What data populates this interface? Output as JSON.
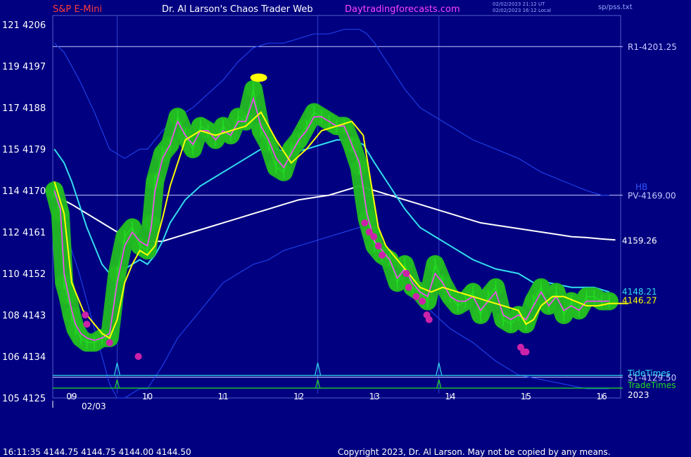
{
  "header": {
    "symbol": "S&P E-Mini",
    "title": "Dr. Al Larson's Chaos Trader Web",
    "website": "Daytradingforecasts.com",
    "timestamp_ut": "02/02/2023 21:12 UT",
    "timestamp_local": "02/02/2023 16:12 Local",
    "file": "sp/pss.txt"
  },
  "footer": {
    "quote": "16:11:35  4144.75 4144.75 4144.00 4144.50",
    "copyright": "Copyright 2023, Dr. Al Larson. May not be copied by any means."
  },
  "chart_data": {
    "type": "line",
    "ylim": [
      4125,
      4208
    ],
    "xlim": [
      8.75,
      16.25
    ],
    "y_ticks": [
      {
        "left": "121",
        "right": "4206",
        "v": 4206
      },
      {
        "left": "119",
        "right": "4197",
        "v": 4197
      },
      {
        "left": "117",
        "right": "4188",
        "v": 4188
      },
      {
        "left": "115",
        "right": "4179",
        "v": 4179
      },
      {
        "left": "114",
        "right": "4170",
        "v": 4170
      },
      {
        "left": "112",
        "right": "4161",
        "v": 4161
      },
      {
        "left": "110",
        "right": "4152",
        "v": 4152
      },
      {
        "left": "108",
        "right": "4143",
        "v": 4143
      },
      {
        "left": "106",
        "right": "4134",
        "v": 4134
      },
      {
        "left": "105",
        "right": "4125",
        "v": 4125
      }
    ],
    "x_ticks": [
      {
        "label": "09",
        "v": 9
      },
      {
        "label": "10",
        "v": 10
      },
      {
        "label": "11",
        "v": 11
      },
      {
        "label": "12",
        "v": 12
      },
      {
        "label": "13",
        "v": 13
      },
      {
        "label": "14",
        "v": 14
      },
      {
        "label": "15",
        "v": 15
      },
      {
        "label": "16",
        "v": 16
      }
    ],
    "date_label": "02/03",
    "year_label": "2023",
    "hlines": [
      {
        "label": "R1-4201.25",
        "value": 4201.25,
        "color": "#c8c8ff"
      },
      {
        "label": "PV-4169.00",
        "value": 4169.0,
        "color": "#c8c8ff"
      },
      {
        "label": "S1-4129.50",
        "value": 4129.5,
        "color": "#c8c8ff"
      }
    ],
    "vlines": [
      9.6,
      12.25,
      13.85
    ],
    "labels": {
      "hb": "HB",
      "tide": "TideTimes",
      "trade": "TradeTimes"
    },
    "colors": {
      "price": "#22dd22",
      "halo": "#22bb22",
      "fast_avg": "#ff44ff",
      "yellow": "#ffff00",
      "cyan": "#33ddee",
      "white": "#ffffff",
      "band": "#1e3ee6",
      "marker": "#cc22aa",
      "bg": "#000080"
    },
    "series": [
      {
        "key": "price",
        "x": [
          8.77,
          8.85,
          8.9,
          8.95,
          9.0,
          9.05,
          9.12,
          9.2,
          9.3,
          9.4,
          9.5,
          9.6,
          9.7,
          9.8,
          9.9,
          10.0,
          10.05,
          10.1,
          10.2,
          10.3,
          10.4,
          10.5,
          10.6,
          10.7,
          10.8,
          10.9,
          11.0,
          11.1,
          11.2,
          11.3,
          11.4,
          11.5,
          11.6,
          11.7,
          11.8,
          11.9,
          12.0,
          12.1,
          12.2,
          12.3,
          12.4,
          12.5,
          12.6,
          12.7,
          12.8,
          12.9,
          12.95,
          13.0,
          13.1,
          13.2,
          13.3,
          13.4,
          13.5,
          13.6,
          13.7,
          13.8,
          13.9,
          14.0,
          14.1,
          14.2,
          14.3,
          14.4,
          14.5,
          14.6,
          14.7,
          14.8,
          14.9,
          15.0,
          15.1,
          15.2,
          15.3,
          15.4,
          15.5,
          15.6,
          15.7,
          15.8,
          15.9,
          16.0,
          16.1
        ],
        "y": [
          4170,
          4165,
          4150,
          4147,
          4143,
          4140,
          4138,
          4137,
          4137,
          4138,
          4138,
          4152,
          4160,
          4162,
          4158,
          4157,
          4163,
          4172,
          4178,
          4180,
          4186,
          4182,
          4179,
          4184,
          4183,
          4181,
          4184,
          4182,
          4186,
          4185,
          4192,
          4183,
          4180,
          4175,
          4174,
          4179,
          4181,
          4184,
          4187,
          4186,
          4185,
          4184,
          4184,
          4180,
          4175,
          4164,
          4161,
          4158,
          4156,
          4155,
          4150,
          4154,
          4149,
          4148,
          4146,
          4154,
          4150,
          4147,
          4145,
          4146,
          4148,
          4143,
          4147,
          4149,
          4142,
          4141,
          4143,
          4141,
          4146,
          4149,
          4145,
          4148,
          4143,
          4146,
          4144,
          4147,
          4147,
          4146,
          4146
        ]
      },
      {
        "key": "fast_avg",
        "x": [
          8.77,
          8.85,
          8.9,
          8.95,
          9.0,
          9.05,
          9.12,
          9.2,
          9.3,
          9.4,
          9.5,
          9.6,
          9.7,
          9.8,
          9.9,
          10.0,
          10.05,
          10.1,
          10.2,
          10.3,
          10.4,
          10.5,
          10.6,
          10.7,
          10.8,
          10.9,
          11.0,
          11.1,
          11.2,
          11.3,
          11.4,
          11.5,
          11.6,
          11.7,
          11.8,
          11.9,
          12.0,
          12.1,
          12.2,
          12.3,
          12.4,
          12.5,
          12.6,
          12.7,
          12.8,
          12.9,
          12.95,
          13.0,
          13.1,
          13.2,
          13.3,
          13.4,
          13.5,
          13.6,
          13.7,
          13.8,
          13.9,
          14.0,
          14.1,
          14.2,
          14.3,
          14.4,
          14.5,
          14.6,
          14.7,
          14.8,
          14.9,
          15.0,
          15.1,
          15.2,
          15.3,
          15.4,
          15.5,
          15.6,
          15.7,
          15.8,
          15.9,
          16.0,
          16.1
        ],
        "y": [
          4170,
          4166,
          4152,
          4148,
          4144,
          4141,
          4139,
          4138,
          4137.5,
          4138,
          4139,
          4150,
          4158,
          4161,
          4159,
          4158,
          4162,
          4170,
          4177,
          4180,
          4185,
          4182,
          4180,
          4183,
          4183,
          4181,
          4183,
          4182,
          4185,
          4185,
          4190,
          4184,
          4181,
          4177,
          4175,
          4178,
          4181,
          4183,
          4186,
          4186,
          4185,
          4184,
          4184,
          4180,
          4176,
          4165,
          4162,
          4159,
          4157,
          4155,
          4151,
          4153,
          4150,
          4148,
          4147,
          4152,
          4150,
          4147,
          4146,
          4146,
          4147,
          4144,
          4146,
          4148,
          4143,
          4142,
          4143,
          4142,
          4145,
          4148,
          4145,
          4147,
          4144,
          4145,
          4144,
          4146,
          4146,
          4146,
          4146
        ]
      },
      {
        "key": "yellow",
        "x": [
          8.77,
          8.9,
          9.0,
          9.15,
          9.3,
          9.4,
          9.5,
          9.6,
          9.7,
          9.8,
          9.9,
          10.0,
          10.1,
          10.2,
          10.3,
          10.5,
          10.7,
          10.9,
          11.1,
          11.3,
          11.5,
          11.7,
          11.9,
          12.1,
          12.3,
          12.5,
          12.7,
          12.85,
          12.95,
          13.05,
          13.15,
          13.3,
          13.45,
          13.6,
          13.75,
          13.9,
          14.1,
          14.3,
          14.5,
          14.7,
          14.9,
          15.0,
          15.1,
          15.2,
          15.35,
          15.5,
          15.65,
          15.8,
          15.95,
          16.1,
          16.25
        ],
        "y": [
          4172,
          4165,
          4150,
          4144,
          4141,
          4139,
          4138,
          4142,
          4150,
          4154,
          4157,
          4156,
          4158,
          4164,
          4171,
          4181,
          4183,
          4182,
          4183,
          4184,
          4187,
          4181,
          4176,
          4179,
          4183,
          4184,
          4185,
          4182,
          4172,
          4162,
          4158,
          4155,
          4152,
          4149,
          4148,
          4149,
          4148,
          4147,
          4146,
          4145,
          4144,
          4141,
          4142,
          4145,
          4147,
          4147,
          4146,
          4145,
          4145,
          4145.5,
          4145.5
        ]
      },
      {
        "key": "cyan",
        "x": [
          8.77,
          8.9,
          9.0,
          9.1,
          9.2,
          9.3,
          9.4,
          9.5,
          9.6,
          9.7,
          9.8,
          9.9,
          10.0,
          10.1,
          10.2,
          10.3,
          10.5,
          10.7,
          10.9,
          11.1,
          11.3,
          11.5,
          11.7,
          11.9,
          12.1,
          12.3,
          12.5,
          12.7,
          12.85,
          13.0,
          13.2,
          13.4,
          13.6,
          13.8,
          14.0,
          14.3,
          14.6,
          14.9,
          15.1,
          15.3,
          15.6,
          15.9,
          16.1
        ],
        "y": [
          4179,
          4176,
          4172,
          4167,
          4162,
          4158,
          4154,
          4152,
          4152,
          4153,
          4154,
          4155,
          4154,
          4156,
          4159,
          4163,
          4168,
          4171,
          4173,
          4175,
          4177,
          4179,
          4179,
          4178,
          4179,
          4180,
          4181,
          4181,
          4180,
          4176,
          4171,
          4166,
          4162,
          4160,
          4158,
          4155,
          4153,
          4152,
          4150,
          4150,
          4149,
          4149,
          4148
        ]
      },
      {
        "key": "white",
        "x": [
          8.77,
          9.0,
          9.2,
          9.4,
          9.6,
          9.8,
          10.0,
          10.2,
          10.4,
          10.6,
          10.8,
          11.0,
          11.2,
          11.4,
          11.6,
          11.8,
          12.0,
          12.2,
          12.4,
          12.6,
          12.8,
          12.9,
          13.0,
          13.2,
          13.4,
          13.6,
          13.8,
          14.0,
          14.2,
          14.4,
          14.6,
          14.8,
          15.0,
          15.2,
          15.4,
          15.6,
          15.8,
          16.0,
          16.18
        ],
        "y": [
          4169,
          4167,
          4165,
          4163,
          4161,
          4160,
          4159,
          4159,
          4160,
          4161,
          4162,
          4163,
          4164,
          4165,
          4166,
          4167,
          4168,
          4168.5,
          4169,
          4170,
          4171,
          4170.5,
          4170,
          4169,
          4168,
          4167,
          4166,
          4165,
          4164,
          4163,
          4162.5,
          4162,
          4161.5,
          4161,
          4160.5,
          4160,
          4159.8,
          4159.5,
          4159.3
        ]
      },
      {
        "key": "band_upper",
        "x": [
          8.77,
          8.9,
          9.1,
          9.3,
          9.5,
          9.7,
          9.8,
          9.9,
          10.0,
          10.2,
          10.4,
          10.6,
          10.8,
          11.0,
          11.2,
          11.4,
          11.6,
          11.8,
          12.0,
          12.2,
          12.4,
          12.6,
          12.8,
          12.9,
          13.0,
          13.2,
          13.4,
          13.6,
          13.8,
          14.0,
          14.3,
          14.6,
          14.9,
          15.2,
          15.5,
          15.8,
          16.0,
          16.1
        ],
        "y": [
          4202,
          4200,
          4194,
          4187,
          4179,
          4177,
          4178,
          4179,
          4179,
          4183,
          4186,
          4188,
          4191,
          4194,
          4198,
          4201,
          4202,
          4202,
          4203,
          4204,
          4204,
          4205,
          4205,
          4204,
          4202,
          4197,
          4192,
          4188,
          4186,
          4184,
          4181,
          4179,
          4177,
          4174,
          4172,
          4170,
          4169,
          4169
        ]
      },
      {
        "key": "band_lower",
        "x": [
          8.77,
          8.9,
          9.1,
          9.3,
          9.5,
          9.6,
          9.7,
          9.8,
          9.9,
          10.0,
          10.2,
          10.4,
          10.6,
          10.8,
          11.0,
          11.2,
          11.4,
          11.6,
          11.8,
          12.0,
          12.2,
          12.4,
          12.6,
          12.8,
          12.9,
          13.0,
          13.2,
          13.4,
          13.6,
          13.8,
          14.0,
          14.3,
          14.6,
          14.9,
          15.2,
          15.5,
          15.8,
          16.0,
          16.1
        ],
        "y": [
          4170,
          4162,
          4152,
          4140,
          4128,
          4125,
          4125,
          4126,
          4127,
          4127,
          4132,
          4138,
          4142,
          4146,
          4150,
          4152,
          4154,
          4155,
          4157,
          4158,
          4159,
          4160,
          4161,
          4162,
          4162,
          4161,
          4155,
          4150,
          4146,
          4143,
          4140,
          4137,
          4133,
          4130,
          4129,
          4128,
          4127,
          4127,
          4127
        ]
      }
    ],
    "markers": {
      "x": [
        9.18,
        9.2,
        9.5,
        9.88,
        12.87,
        12.93,
        12.99,
        13.05,
        13.1,
        13.42,
        13.45,
        13.55,
        13.63,
        13.69,
        13.72,
        14.93,
        14.97,
        15.0
      ],
      "y": [
        4143,
        4141,
        4137,
        4134,
        4163,
        4161,
        4160,
        4158,
        4156,
        4152,
        4149,
        4147,
        4146,
        4143,
        4142,
        4136,
        4135,
        4135
      ]
    },
    "highlight": {
      "x": 11.47,
      "y": 4194.5
    },
    "end_labels": [
      {
        "text": "4159.26",
        "y": 4159.26,
        "color": "#ffffff"
      },
      {
        "text": "4148.21",
        "y": 4148.21,
        "color": "#33ddee"
      },
      {
        "text": "4146.27",
        "y": 4146.27,
        "color": "#ffff00"
      }
    ]
  }
}
